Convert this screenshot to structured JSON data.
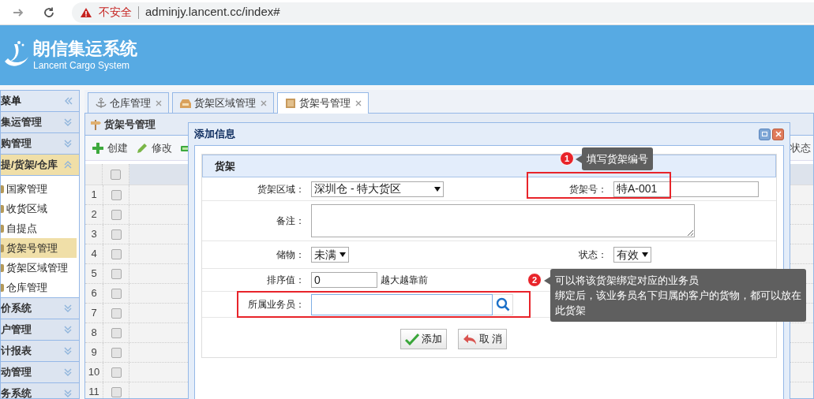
{
  "browser": {
    "security_label": "不安全",
    "url": "adminjy.lancent.cc/index#"
  },
  "header": {
    "title": "朗信集运系统",
    "subtitle": "Lancent Cargo System"
  },
  "sidebar": {
    "title": "菜单",
    "groups": [
      {
        "label": "集运管理",
        "expanded": false
      },
      {
        "label": "购管理",
        "expanded": false
      },
      {
        "label": "提/货架/仓库",
        "expanded": true,
        "children": [
          {
            "label": "国家管理",
            "selected": false
          },
          {
            "label": "收货区域",
            "selected": false
          },
          {
            "label": "自提点",
            "selected": false
          },
          {
            "label": "货架号管理",
            "selected": true
          },
          {
            "label": "货架区域管理",
            "selected": false
          },
          {
            "label": "仓库管理",
            "selected": false
          }
        ]
      },
      {
        "label": "价系统",
        "expanded": false
      },
      {
        "label": "户管理",
        "expanded": false
      },
      {
        "label": "计报表",
        "expanded": false
      },
      {
        "label": "动管理",
        "expanded": false
      },
      {
        "label": "务系统",
        "expanded": false
      }
    ]
  },
  "tabs": [
    {
      "label": "仓库管理",
      "selected": false
    },
    {
      "label": "货架区域管理",
      "selected": false
    },
    {
      "label": "货架号管理",
      "selected": true
    }
  ],
  "panel": {
    "title": "货架号管理",
    "toolbar": [
      "创建",
      "修改"
    ],
    "toolbar_right": "状态"
  },
  "grid": {
    "select_all_checked": false,
    "rows": [
      {
        "number": "1",
        "checked": false
      },
      {
        "number": "2",
        "checked": false
      },
      {
        "number": "3",
        "checked": false
      },
      {
        "number": "4",
        "checked": false
      },
      {
        "number": "5",
        "checked": false
      },
      {
        "number": "6",
        "checked": false
      },
      {
        "number": "7",
        "checked": false
      },
      {
        "number": "8",
        "checked": false
      },
      {
        "number": "9",
        "checked": false
      },
      {
        "number": "10",
        "checked": false
      },
      {
        "number": "11",
        "checked": false
      }
    ]
  },
  "dialog": {
    "title": "添加信息",
    "section": "货架",
    "rows": [
      [
        {
          "label": "货架区域：",
          "kind": "select",
          "value": "深圳仓 - 特大货区"
        },
        {
          "label": "货架号：",
          "kind": "text",
          "value": "特A-001"
        }
      ],
      [
        {
          "label": "备注：",
          "kind": "textarea"
        }
      ],
      [
        {
          "label": "储物：",
          "kind": "select",
          "value": "未满"
        },
        {
          "label": "状态：",
          "kind": "select",
          "value": "有效"
        }
      ],
      [
        {
          "label": "排序值：",
          "kind": "text",
          "value": "0",
          "hint": "越大越靠前"
        }
      ],
      [
        {
          "label": "所属业务员：",
          "kind": "lookup"
        }
      ]
    ],
    "buttons": [
      "添加",
      "取 消"
    ]
  },
  "annotations": [
    {
      "number": "1",
      "lines": [
        "填写货架编号"
      ]
    },
    {
      "number": "2",
      "lines": [
        "可以将该货架绑定对应的业务员",
        "绑定后，该业务员名下归属的客户的货物，都可以放在",
        "此货架"
      ]
    }
  ]
}
